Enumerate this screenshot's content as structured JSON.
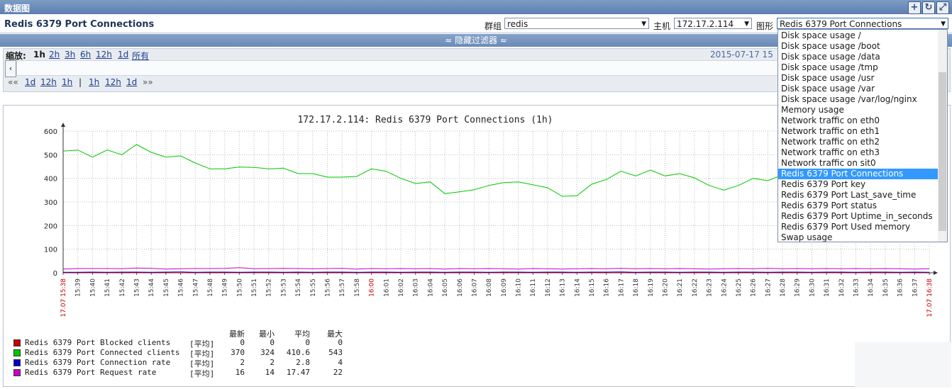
{
  "window": {
    "title": "数据图"
  },
  "header": {
    "page_title": "Redis 6379 Port Connections",
    "group_label": "群组",
    "group_value": "redis",
    "host_label": "主机",
    "host_value": "172.17.2.114",
    "graph_label": "图形",
    "graph_value": "Redis 6379 Port Connections"
  },
  "filter": {
    "toggle_label": "≈ 隐藏过滤器 ≈"
  },
  "zoom": {
    "label": "缩放:",
    "options": [
      "1h",
      "2h",
      "3h",
      "6h",
      "12h",
      "1d",
      "所有"
    ],
    "active": "1h",
    "date_text": "2015-07-17 15",
    "nav_back_all": "««",
    "nav_back": [
      "1d",
      "12h",
      "1h"
    ],
    "separator": "|",
    "nav_fwd": [
      "1h",
      "12h",
      "1d"
    ],
    "nav_fwd_all": "»»"
  },
  "dropdown": {
    "items": [
      "Disk space usage /",
      "Disk space usage /boot",
      "Disk space usage /data",
      "Disk space usage /tmp",
      "Disk space usage /usr",
      "Disk space usage /var",
      "Disk space usage /var/log/nginx",
      "Memory usage",
      "Network traffic on eth0",
      "Network traffic on eth1",
      "Network traffic on eth2",
      "Network traffic on eth3",
      "Network traffic on sit0",
      "Redis 6379 Port Connections",
      "Redis 6379 Port key",
      "Redis 6379 Port Last_save_time",
      "Redis 6379 Port status",
      "Redis 6379 Port Uptime_in_seconds",
      "Redis 6379 Port Used memory",
      "Swap usage"
    ],
    "selected_index": 13
  },
  "chart_data": {
    "type": "line",
    "title": "172.17.2.114: Redis 6379 Port Connections (1h)",
    "ylim": [
      0,
      600
    ],
    "yticks": [
      0,
      100,
      200,
      300,
      400,
      500,
      600
    ],
    "x_labels": [
      "17.07 15:38",
      "15:39",
      "15:40",
      "15:41",
      "15:42",
      "15:43",
      "15:44",
      "15:45",
      "15:46",
      "15:47",
      "15:48",
      "15:49",
      "15:50",
      "15:51",
      "15:52",
      "15:53",
      "15:54",
      "15:55",
      "15:56",
      "15:57",
      "15:58",
      "16:00",
      "16:01",
      "16:02",
      "16:03",
      "16:04",
      "16:05",
      "16:06",
      "16:07",
      "16:08",
      "16:09",
      "16:10",
      "16:11",
      "16:12",
      "16:13",
      "16:14",
      "16:15",
      "16:16",
      "16:17",
      "16:18",
      "16:19",
      "16:20",
      "16:21",
      "16:22",
      "16:23",
      "16:24",
      "16:25",
      "16:26",
      "16:27",
      "16:28",
      "16:29",
      "16:30",
      "16:31",
      "16:32",
      "16:33",
      "16:34",
      "16:35",
      "16:36",
      "16:37",
      "17.07 16:38"
    ],
    "red_labels": [
      "17.07 15:38",
      "16:00",
      "17.07 16:38"
    ],
    "grid": true,
    "series": [
      {
        "name": "Redis 6379 Port Blocked clients",
        "color": "#c80000",
        "values": [
          0,
          0,
          0,
          0,
          0,
          0,
          0,
          0,
          0,
          0,
          0,
          0,
          0,
          0,
          0,
          0,
          0,
          0,
          0,
          0,
          0,
          0,
          0,
          0,
          0,
          0,
          0,
          0,
          0,
          0,
          0,
          0,
          0,
          0,
          0,
          0,
          0,
          0,
          0,
          0,
          0,
          0,
          0,
          0,
          0,
          0,
          0,
          0,
          0,
          0,
          0,
          0,
          0,
          0,
          0,
          0,
          0,
          0,
          0,
          0
        ]
      },
      {
        "name": "Redis 6379 Port Connected clients",
        "color": "#00c800",
        "values": [
          515,
          520,
          490,
          520,
          500,
          543,
          510,
          490,
          495,
          465,
          440,
          440,
          448,
          446,
          440,
          443,
          420,
          420,
          405,
          405,
          408,
          440,
          430,
          400,
          378,
          385,
          335,
          343,
          352,
          370,
          382,
          385,
          373,
          360,
          324,
          326,
          375,
          395,
          430,
          410,
          435,
          410,
          420,
          402,
          370,
          350,
          370,
          400,
          390,
          415,
          405,
          390,
          395,
          420,
          410,
          430,
          415,
          400,
          395,
          370
        ]
      },
      {
        "name": "Redis 6379 Port Connection rate",
        "color": "#0000c8",
        "values": [
          2,
          2,
          3,
          2,
          3,
          3,
          2,
          3,
          4,
          2,
          3,
          3,
          2,
          3,
          3,
          2,
          3,
          2,
          3,
          3,
          2,
          3,
          3,
          2,
          3,
          3,
          2,
          3,
          3,
          2,
          3,
          3,
          2,
          3,
          3,
          2,
          3,
          3,
          4,
          2,
          3,
          3,
          2,
          3,
          3,
          2,
          3,
          3,
          2,
          3,
          3,
          2,
          3,
          3,
          2,
          3,
          3,
          2,
          3,
          2
        ]
      },
      {
        "name": "Redis 6379 Port Request rate",
        "color": "#c800c8",
        "values": [
          16,
          18,
          18,
          18,
          17,
          20,
          19,
          16,
          17,
          18,
          18,
          19,
          22,
          17,
          18,
          19,
          18,
          17,
          18,
          19,
          16,
          18,
          17,
          18,
          17,
          18,
          16,
          18,
          17,
          18,
          17,
          16,
          18,
          17,
          16,
          17,
          18,
          17,
          19,
          17,
          18,
          17,
          18,
          17,
          16,
          17,
          18,
          17,
          19,
          17,
          18,
          17,
          18,
          17,
          18,
          17,
          18,
          17,
          16,
          17
        ]
      }
    ],
    "legend": {
      "headers": [
        "最新",
        "最小",
        "平均",
        "最大"
      ],
      "func_label": "[平均]",
      "rows": [
        {
          "name": "Redis 6379 Port Blocked clients",
          "color": "#c80000",
          "last": "0",
          "min": "0",
          "avg": "0",
          "max": "0"
        },
        {
          "name": "Redis 6379 Port Connected clients",
          "color": "#00c800",
          "last": "370",
          "min": "324",
          "avg": "410.6",
          "max": "543"
        },
        {
          "name": "Redis 6379 Port Connection rate",
          "color": "#0000c8",
          "last": "2",
          "min": "2",
          "avg": "2.8",
          "max": "4"
        },
        {
          "name": "Redis 6379 Port Request rate",
          "color": "#c800c8",
          "last": "16",
          "min": "14",
          "avg": "17.47",
          "max": "22"
        }
      ]
    }
  }
}
